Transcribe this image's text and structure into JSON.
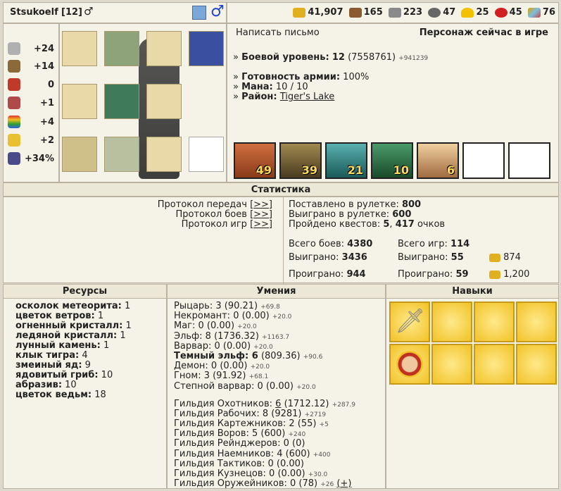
{
  "header": {
    "player_name": "Stsukoelf",
    "level": "[12]",
    "resources": [
      {
        "icon": "gold-icon",
        "value": "41,907",
        "color": "#e0b020"
      },
      {
        "icon": "wood-icon",
        "value": "165",
        "color": "#8a5a30"
      },
      {
        "icon": "ore-icon",
        "value": "223",
        "color": "#8a8a8a"
      },
      {
        "icon": "mercury-icon",
        "value": "47",
        "color": "#666666"
      },
      {
        "icon": "sulfur-icon",
        "value": "25",
        "color": "#f2c200"
      },
      {
        "icon": "crystal-icon",
        "value": "45",
        "color": "#d02020"
      },
      {
        "icon": "gems-icon",
        "value": "76",
        "color": "#e0a000"
      }
    ]
  },
  "stats": [
    {
      "icon": "attack-icon",
      "value": "+24"
    },
    {
      "icon": "defense-icon",
      "value": "+14"
    },
    {
      "icon": "spellpower-icon",
      "value": "0"
    },
    {
      "icon": "knowledge-icon",
      "value": "+1"
    },
    {
      "icon": "luck-icon",
      "value": "+4"
    },
    {
      "icon": "morale-icon",
      "value": "+2"
    },
    {
      "icon": "initiative-icon",
      "value": "+34%"
    }
  ],
  "info": {
    "write_letter": "Написать письмо",
    "status": "Персонаж сейчас в игре",
    "combat_level_label": "Боевой уровень:",
    "combat_level_value": "12",
    "combat_level_exp": "(7558761)",
    "combat_level_extra": "+941239",
    "army_ready_label": "Готовность армии:",
    "army_ready_value": "100%",
    "mana_label": "Мана:",
    "mana_value": "10 / 10",
    "district_label": "Район:",
    "district_value": "Tiger's Lake",
    "army": [
      {
        "count": "49",
        "color": "#c05a2a"
      },
      {
        "count": "39",
        "color": "#7a6a40"
      },
      {
        "count": "21",
        "color": "#3a8a8a"
      },
      {
        "count": "10",
        "color": "#2a6a4a"
      },
      {
        "count": "6",
        "color": "#d0a080"
      },
      {
        "count": ""
      },
      {
        "count": ""
      }
    ]
  },
  "statistics": {
    "title": "Статистика",
    "protocol_transfers": "Протокол передач",
    "protocol_battles": "Протокол боев",
    "protocol_games": "Протокол игр",
    "link": "[>>]",
    "roulette_bet_label": "Поставлено в рулетке:",
    "roulette_bet_value": "800",
    "roulette_won_label": "Выиграно в рулетке:",
    "roulette_won_value": "600",
    "quests_label": "Пройдено квестов:",
    "quests_count": "5",
    "quests_points": "417",
    "quests_suffix": "очков",
    "battles_total_label": "Всего боев:",
    "battles_total": "4380",
    "battles_won_label": "Выиграно:",
    "battles_won": "3436",
    "battles_lost_label": "Проиграно:",
    "battles_lost": "944",
    "games_total_label": "Всего игр:",
    "games_total": "114",
    "games_won_label": "Выиграно:",
    "games_won": "55",
    "games_lost_label": "Проиграно:",
    "games_lost": "59",
    "games_won_gold": "874",
    "games_lost_gold": "1,200"
  },
  "resources_panel": {
    "title": "Ресурсы",
    "items": [
      {
        "name": "осколок метеорита:",
        "value": "1"
      },
      {
        "name": "цветок ветров:",
        "value": "1"
      },
      {
        "name": "огненный кристалл:",
        "value": "1"
      },
      {
        "name": "ледяной кристалл:",
        "value": "1"
      },
      {
        "name": "лунный камень:",
        "value": "1"
      },
      {
        "name": "клык тигра:",
        "value": "4"
      },
      {
        "name": "змеиный яд:",
        "value": "9"
      },
      {
        "name": "ядовитый гриб:",
        "value": "10"
      },
      {
        "name": "абразив:",
        "value": "10"
      },
      {
        "name": "цветок ведьм:",
        "value": "18"
      }
    ]
  },
  "skills_panel": {
    "title": "Умения",
    "factions": [
      {
        "text": "Рыцарь: 3 (90.21)",
        "extra": "+69.8",
        "bold": false
      },
      {
        "text": "Некромант: 0 (0.00)",
        "extra": "+20.0",
        "bold": false
      },
      {
        "text": "Маг: 0 (0.00)",
        "extra": "+20.0",
        "bold": false
      },
      {
        "text": "Эльф: 8 (1736.32)",
        "extra": "+1163.7",
        "bold": false
      },
      {
        "text": "Варвар: 0 (0.00)",
        "extra": "+20.0",
        "bold": false
      },
      {
        "text": "Темный эльф: 6",
        "text2": "(809.36)",
        "extra": "+90.6",
        "bold": true
      },
      {
        "text": "Демон: 0 (0.00)",
        "extra": "+20.0",
        "bold": false
      },
      {
        "text": "Гном: 3 (91.92)",
        "extra": "+68.1",
        "bold": false
      },
      {
        "text": "Степной варвар: 0 (0.00)",
        "extra": "+20.0",
        "bold": false
      }
    ],
    "guilds": [
      {
        "text": "Гильдия Охотников:",
        "num": "6",
        "text2": "(1712.12)",
        "extra": "+287.9"
      },
      {
        "text": "Гильдия Рабочих: 8 (9281)",
        "extra": "+2719"
      },
      {
        "text": "Гильдия Картежников: 2 (55)",
        "extra": "+5"
      },
      {
        "text": "Гильдия Воров: 5 (600)",
        "extra": "+240"
      },
      {
        "text": "Гильдия Рейнджеров: 0 (0)",
        "extra": ""
      },
      {
        "text": "Гильдия Наемников: 4 (600)",
        "extra": "+400"
      },
      {
        "text": "Гильдия Тактиков: 0 (0.00)",
        "extra": ""
      },
      {
        "text": "Гильдия Кузнецов: 0 (0.00)",
        "extra": "+30.0"
      },
      {
        "text": "Гильдия Оружейников: 0 (78)",
        "extra": "+26",
        "plus": "(+)"
      }
    ]
  },
  "abilities_panel": {
    "title": "Навыки"
  }
}
